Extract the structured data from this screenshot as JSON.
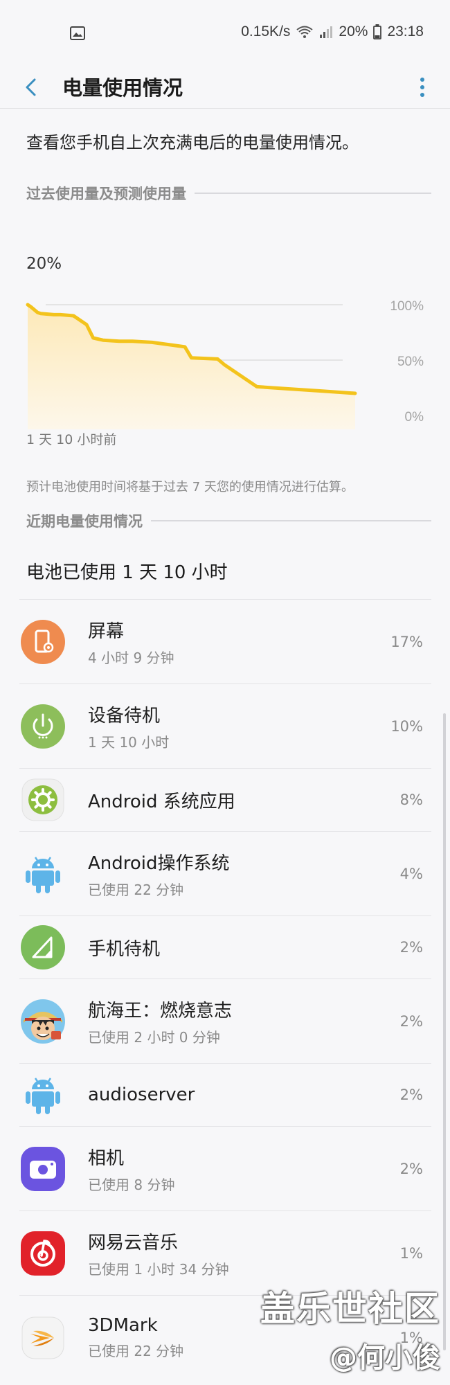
{
  "status_bar": {
    "net_speed": "0.15K/s",
    "battery_percent": "20%",
    "time": "23:18",
    "icons": [
      "gallery-icon",
      "wifi-icon",
      "signal-icon",
      "battery-icon"
    ]
  },
  "app_bar": {
    "title": "电量使用情况",
    "icons": [
      "back-icon",
      "more-vert-icon"
    ]
  },
  "intro_text": "查看您手机自上次充满电后的电量使用情况。",
  "section1": {
    "title": "过去使用量及预测使用量"
  },
  "current_level": "20%",
  "chart_data": {
    "type": "area",
    "y_tick_labels": [
      "100%",
      "50%",
      "0%"
    ],
    "ylim": [
      0,
      100
    ],
    "x_start_label": "1 天 10 小时前",
    "x": [
      0,
      1,
      3,
      4,
      8,
      9,
      10,
      14,
      18,
      20,
      23,
      28,
      29,
      32,
      38,
      48,
      50,
      58,
      60,
      70,
      80,
      90,
      100
    ],
    "values": [
      100,
      98,
      93,
      92,
      91,
      91,
      91,
      90,
      82,
      70,
      68,
      67,
      67,
      67,
      66,
      62,
      52,
      51,
      46,
      26,
      24,
      22,
      20
    ],
    "colors": {
      "line": "#f3c31c",
      "fill_top": "#fde9b8",
      "fill_bottom": "#fdf7ea",
      "grid": "#dedede"
    },
    "grid": true
  },
  "forecast_note": "预计电池使用时间将基于过去 7 天您的使用情况进行估算。",
  "section2": {
    "title": "近期电量使用情况"
  },
  "usage_total": "电池已使用 1 天 10 小时",
  "apps": [
    {
      "name": "屏幕",
      "sub": "4 小时 9 分钟",
      "percent": "17%",
      "icon": "screen-icon",
      "color": "#ef8b4f"
    },
    {
      "name": "设备待机",
      "sub": "1 天 10 小时",
      "percent": "10%",
      "icon": "power-standby-icon",
      "color": "#8dbe5b"
    },
    {
      "name": "Android 系统应用",
      "sub": "",
      "percent": "8%",
      "icon": "android-system-gear-icon",
      "color": "#8dbe3f"
    },
    {
      "name": "Android操作系统",
      "sub": "已使用 22 分钟",
      "percent": "4%",
      "icon": "android-robot-icon",
      "color": "#5db4e8"
    },
    {
      "name": "手机待机",
      "sub": "",
      "percent": "2%",
      "icon": "cell-standby-icon",
      "color": "#7cbc5a"
    },
    {
      "name": "航海王：燃烧意志",
      "sub": "已使用 2 小时 0 分钟",
      "percent": "2%",
      "icon": "one-piece-game-icon",
      "color": "#d8553a"
    },
    {
      "name": "audioserver",
      "sub": "",
      "percent": "2%",
      "icon": "android-robot-icon",
      "color": "#5db4e8"
    },
    {
      "name": "相机",
      "sub": "已使用 8 分钟",
      "percent": "2%",
      "icon": "camera-icon",
      "color": "#6b54e0"
    },
    {
      "name": "网易云音乐",
      "sub": "已使用 1 小时 34 分钟",
      "percent": "1%",
      "icon": "netease-music-icon",
      "color": "#e1222a"
    },
    {
      "name": "3DMark",
      "sub": "已使用 22 分钟",
      "percent": "1%",
      "icon": "3dmark-icon",
      "color": "#f39a1e"
    }
  ],
  "watermark": {
    "line1": "盖乐世社区",
    "line2": "@何小俊"
  }
}
